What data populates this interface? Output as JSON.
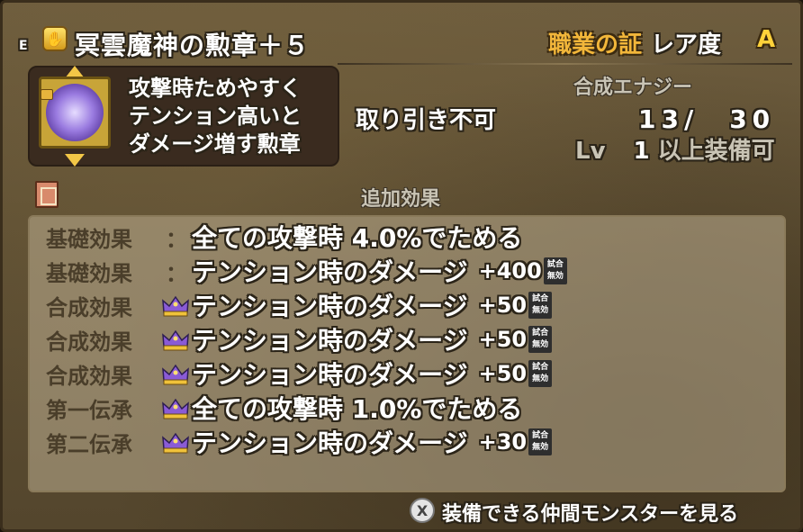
{
  "header": {
    "equipped_mark": "E",
    "item_icon": "medal-icon",
    "item_name": "冥雲魔神の勲章＋５",
    "job_tag": "職業の証",
    "rarity_label": "レア度",
    "rarity_value": "A"
  },
  "description": {
    "line1": "攻撃時ためやすく",
    "line2": "テンション高いと",
    "line3": "ダメージ増す勲章"
  },
  "trade_status": "取り引き不可",
  "energy": {
    "label": "合成エナジー",
    "value": "13/　30"
  },
  "level": {
    "prefix": "Lv",
    "value": "1",
    "suffix": "以上装備可"
  },
  "extra_effects_title": "追加効果",
  "effects": [
    {
      "category": "基礎効果",
      "sep": "：",
      "crown": false,
      "text": "全ての攻撃時 4.0%でためる",
      "value": "",
      "badge": ""
    },
    {
      "category": "基礎効果",
      "sep": "：",
      "crown": false,
      "text": "テンション時のダメージ",
      "value": "+400",
      "badge": "試合無効"
    },
    {
      "category": "合成効果",
      "sep": "",
      "crown": true,
      "text": "テンション時のダメージ",
      "value": "+50",
      "badge": "試合無効"
    },
    {
      "category": "合成効果",
      "sep": "",
      "crown": true,
      "text": "テンション時のダメージ",
      "value": "+50",
      "badge": "試合無効"
    },
    {
      "category": "合成効果",
      "sep": "",
      "crown": true,
      "text": "テンション時のダメージ",
      "value": "+50",
      "badge": "試合無効"
    },
    {
      "category": "第一伝承",
      "sep": "",
      "crown": true,
      "text": "全ての攻撃時 1.0%でためる",
      "value": "",
      "badge": ""
    },
    {
      "category": "第二伝承",
      "sep": "",
      "crown": true,
      "text": "テンション時のダメージ",
      "value": "+30",
      "badge": "試合無効"
    }
  ],
  "footer": {
    "button_glyph": "X",
    "label": "装備できる仲間モンスターを見る"
  },
  "colors": {
    "job_tag": "#f2b63a",
    "rarity": "#ffd23a",
    "effects_bg": "#beaf91"
  }
}
